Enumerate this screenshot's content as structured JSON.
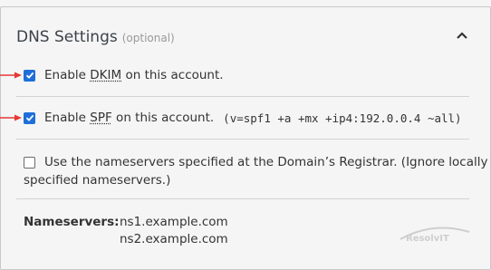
{
  "section": {
    "title": "DNS Settings",
    "optional_label": "(optional)",
    "collapse_icon": "chevron-up-icon"
  },
  "options": [
    {
      "checked": true,
      "prefix": "Enable ",
      "abbr": "DKIM",
      "suffix": " on this account.",
      "record": ""
    },
    {
      "checked": true,
      "prefix": "Enable ",
      "abbr": "SPF",
      "suffix": " on this account.",
      "record": "(v=spf1 +a +mx +ip4:192.0.0.4 ~all)"
    },
    {
      "checked": false,
      "line1": "Use the nameservers specified at the Domain’s Registrar. (Ignore locally",
      "line2": "specified nameservers.)"
    }
  ],
  "nameservers": {
    "label": "Nameservers:",
    "values": [
      "ns1.example.com",
      "ns2.example.com"
    ]
  },
  "watermark": {
    "text": "ResolvIT"
  },
  "colors": {
    "accent": "#1e6fd9",
    "arrow": "#e53935",
    "border": "#c8c8c8"
  }
}
